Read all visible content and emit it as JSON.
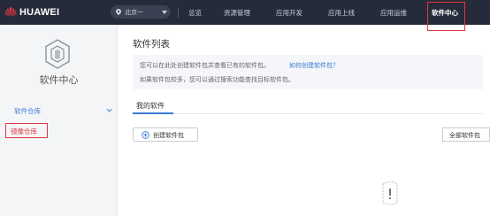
{
  "header": {
    "brand": "HUAWEI",
    "region": "北京一",
    "nav": [
      "总览",
      "资源管理",
      "应用开发",
      "应用上线",
      "应用运维",
      "软件中心"
    ],
    "active_nav": "软件中心",
    "colors": {
      "bar": "#252b3a",
      "highlight": "#e0383e"
    },
    "icons": [
      "huawei-logo-icon",
      "location-pin-icon",
      "caret-down-icon"
    ]
  },
  "sidebar": {
    "title": "软件中心",
    "icon": "package-box-icon",
    "group_label": "软件仓库",
    "sub_item_label": "镜像仓库",
    "colors": {
      "accent": "#3a7bd5"
    }
  },
  "main": {
    "title": "软件列表",
    "info_line1": "您可以在此处创建软件包并查看已有的软件包。",
    "info_link": "如何创建软件包？",
    "info_line2": "如果软件包较多，您可以通过搜索功能查找目标软件包。",
    "tab": "我的软件",
    "create_button": "创建软件包",
    "filter": "全部软件包",
    "empty_icon": "empty-box-icon"
  }
}
